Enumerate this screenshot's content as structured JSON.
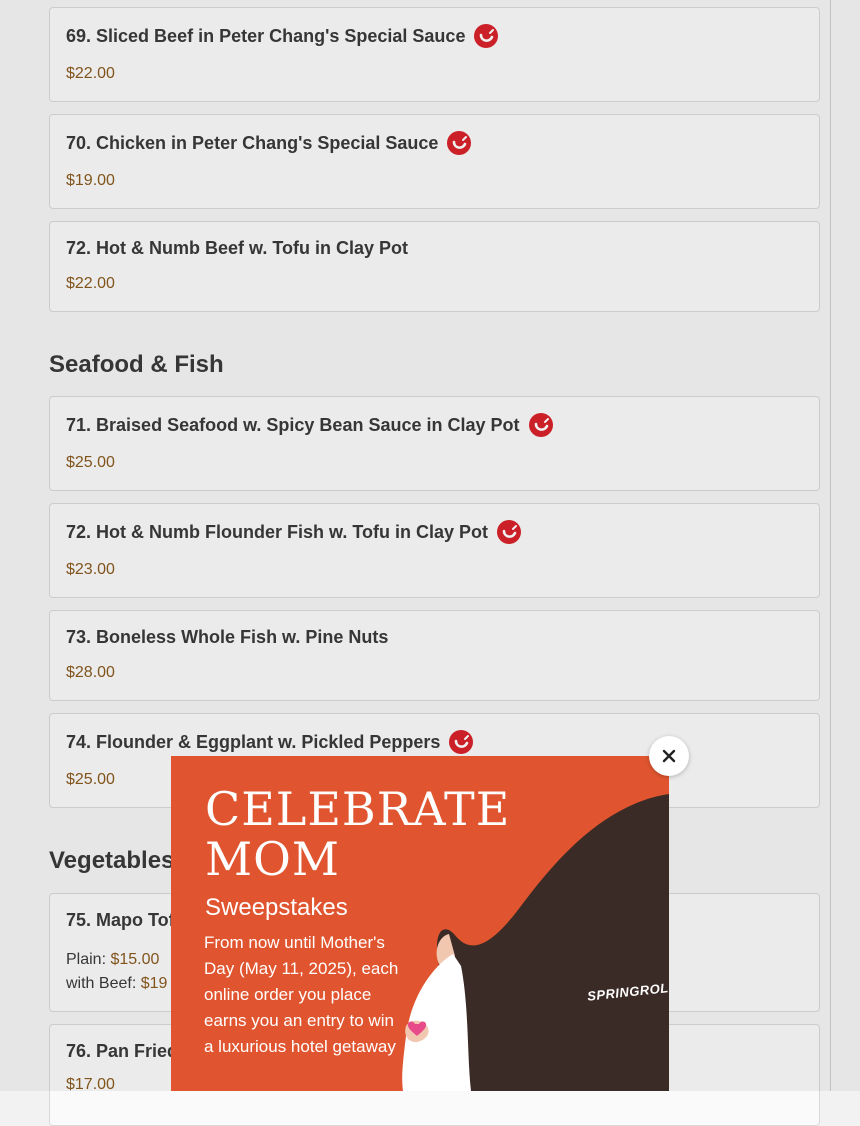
{
  "menu": {
    "items": [
      {
        "number": "69.",
        "name": "Sliced Beef in Peter Chang's Special Sauce",
        "spicy": true,
        "price": "$22.00"
      },
      {
        "number": "70.",
        "name": "Chicken in Peter Chang's Special Sauce",
        "spicy": true,
        "price": "$19.00"
      },
      {
        "number": "72.",
        "name": "Hot & Numb Beef w. Tofu in Clay Pot",
        "spicy": false,
        "price": "$22.00"
      }
    ],
    "sections": [
      {
        "title": "Seafood & Fish",
        "items": [
          {
            "number": "71.",
            "name": "Braised Seafood w. Spicy Bean Sauce in Clay Pot",
            "spicy": true,
            "price": "$25.00"
          },
          {
            "number": "72.",
            "name": "Hot & Numb Flounder Fish w. Tofu in Clay Pot",
            "spicy": true,
            "price": "$23.00"
          },
          {
            "number": "73.",
            "name": "Boneless Whole Fish w. Pine Nuts",
            "spicy": false,
            "price": "$28.00"
          },
          {
            "number": "74.",
            "name": "Flounder & Eggplant w. Pickled Peppers",
            "spicy": true,
            "price": "$25.00"
          }
        ]
      },
      {
        "title": "Vegetables",
        "items": [
          {
            "number": "75.",
            "name": "Mapo Tofu",
            "spicy": false,
            "price_options": [
              {
                "label": "Plain:",
                "price": "$15.00"
              },
              {
                "label": "with Beef:",
                "price": "$19"
              }
            ]
          },
          {
            "number": "76.",
            "name": "Pan Fried",
            "spicy": false,
            "price": "$17.00"
          }
        ]
      }
    ]
  },
  "promo": {
    "heading": "CELEBRATE MOM",
    "subheading": "Sweepstakes",
    "body": "From now until Mother's Day (May 11, 2025), each online order you place earns you an entry to win a luxurious hotel getaway",
    "brand": "SPRINGROLL",
    "close_icon": "close-icon"
  },
  "colors": {
    "price": "#8a5a1e",
    "spicy_badge": "#d8232a",
    "promo_bg": "#e0552f",
    "promo_hair": "#3b2b26"
  }
}
